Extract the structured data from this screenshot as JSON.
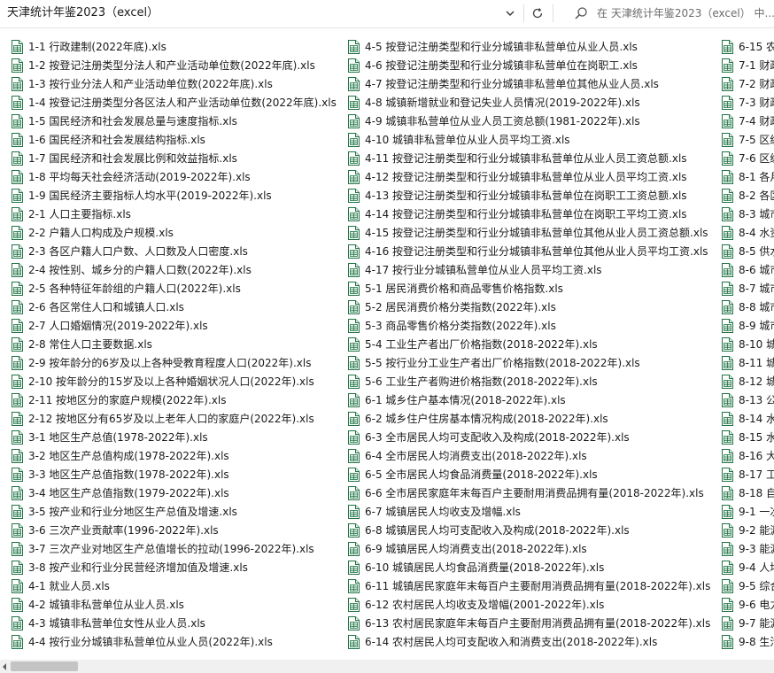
{
  "address_bar": {
    "path": "天津统计年鉴2023（excel）",
    "search_placeholder": "在 天津统计年鉴2023（excel） 中..."
  },
  "icons": {
    "file": "excel-file-icon",
    "dropdown": "chevron-down-icon",
    "refresh": "refresh-icon",
    "search": "search-icon"
  },
  "colors": {
    "excel_green": "#217346",
    "scrollbar_thumb": "#c4c4c4"
  },
  "files": {
    "column1": [
      "1-1 行政建制(2022年底).xls",
      "1-2 按登记注册类型分法人和产业活动单位数(2022年底).xls",
      "1-3 按行业分法人和产业活动单位数(2022年底).xls",
      "1-4 按登记注册类型分各区法人和产业活动单位数(2022年底).xls",
      "1-5 国民经济和社会发展总量与速度指标.xls",
      "1-6 国民经济和社会发展结构指标.xls",
      "1-7 国民经济和社会发展比例和效益指标.xls",
      "1-8 平均每天社会经济活动(2019-2022年).xls",
      "1-9 国民经济主要指标人均水平(2019-2022年).xls",
      "2-1 人口主要指标.xls",
      "2-2 户籍人口构成及户规模.xls",
      "2-3 各区户籍人口户数、人口数及人口密度.xls",
      "2-4 按性别、城乡分的户籍人口数(2022年).xls",
      "2-5 各种特征年龄组的户籍人口(2022年).xls",
      "2-6 各区常住人口和城镇人口.xls",
      "2-7 人口婚姻情况(2019-2022年).xls",
      "2-8 常住人口主要数据.xls",
      "2-9 按年龄分的6岁及以上各种受教育程度人口(2022年).xls",
      "2-10 按年龄分的15岁及以上各种婚姻状况人口(2022年).xls",
      "2-11 按地区分的家庭户规模(2022年).xls",
      "2-12 按地区分有65岁及以上老年人口的家庭户(2022年).xls",
      "3-1 地区生产总值(1978-2022年).xls",
      "3-2 地区生产总值构成(1978-2022年).xls",
      "3-3 地区生产总值指数(1978-2022年).xls",
      "3-4 地区生产总值指数(1979-2022年).xls",
      "3-5 按产业和行业分地区生产总值及增速.xls",
      "3-6 三次产业贡献率(1996-2022年).xls",
      "3-7 三次产业对地区生产总值增长的拉动(1996-2022年).xls",
      "3-8 按产业和行业分民营经济增加值及增速.xls",
      "4-1 就业人员.xls",
      "4-2 城镇非私营单位从业人员.xls",
      "4-3 城镇非私营单位女性从业人员.xls",
      "4-4 按行业分城镇非私营单位从业人员(2022年).xls"
    ],
    "column2": [
      "4-5 按登记注册类型和行业分城镇非私营单位从业人员.xls",
      "4-6 按登记注册类型和行业分城镇非私营单位在岗职工.xls",
      "4-7 按登记注册类型和行业分城镇非私营单位其他从业人员.xls",
      "4-8 城镇新增就业和登记失业人员情况(2019-2022年).xls",
      "4-9 城镇非私营单位从业人员工资总额(1981-2022年).xls",
      "4-10 城镇非私营单位从业人员平均工资.xls",
      "4-11 按登记注册类型和行业分城镇非私营单位从业人员工资总额.xls",
      "4-12 按登记注册类型和行业分城镇非私营单位从业人员平均工资.xls",
      "4-13 按登记注册类型和行业分城镇非私营单位在岗职工工资总额.xls",
      "4-14 按登记注册类型和行业分城镇非私营单位在岗职工平均工资.xls",
      "4-15 按登记注册类型和行业分城镇非私营单位其他从业人员工资总额.xls",
      "4-16 按登记注册类型和行业分城镇非私营单位其他从业人员平均工资.xls",
      "4-17 按行业分城镇私营单位从业人员平均工资.xls",
      "5-1 居民消费价格和商品零售价格指数.xls",
      "5-2 居民消费价格分类指数(2022年).xls",
      "5-3 商品零售价格分类指数(2022年).xls",
      "5-4 工业生产者出厂价格指数(2018-2022年).xls",
      "5-5 按行业分工业生产者出厂价格指数(2018-2022年).xls",
      "5-6 工业生产者购进价格指数(2018-2022年).xls",
      "6-1 城乡住户基本情况(2018-2022年).xls",
      "6-2 城乡住户住房基本情况构成(2018-2022年).xls",
      "6-3 全市居民人均可支配收入及构成(2018-2022年).xls",
      "6-4 全市居民人均消费支出(2018-2022年).xls",
      "6-5 全市居民人均食品消费量(2018-2022年).xls",
      "6-6 全市居民家庭年末每百户主要耐用消费品拥有量(2018-2022年).xls",
      "6-7 城镇居民人均收支及增幅.xls",
      "6-8 城镇居民人均可支配收入及构成(2018-2022年).xls",
      "6-9 城镇居民人均消费支出(2018-2022年).xls",
      "6-10 城镇居民人均食品消费量(2018-2022年).xls",
      "6-11 城镇居民家庭年末每百户主要耐用消费品拥有量(2018-2022年).xls",
      "6-12 农村居民人均收支及增幅(2001-2022年).xls",
      "6-13 农村居民家庭年末每百户主要耐用消费品拥有量(2018-2022年).xls",
      "6-14 农村居民人均可支配收入和消费支出(2018-2022年).xls"
    ],
    "column3": [
      "6-15 农",
      "7-1 财政",
      "7-2 财政",
      "7-3 财政",
      "7-4 财政",
      "7-5 区级",
      "7-6 区级",
      "8-1 各月",
      "8-2 各区",
      "8-3 城市",
      "8-4 水资",
      "8-5 供水",
      "8-6 城市",
      "8-7 城市",
      "8-8 城市",
      "8-9 城市",
      "8-10 城",
      "8-11 城",
      "8-12 城",
      "8-13 公",
      "8-14 水",
      "8-15 水",
      "8-16 大",
      "8-17 工",
      "8-18 自",
      "9-1 一次",
      "9-2 能源",
      "9-3 能源",
      "9-4 人均",
      "9-5 综合",
      "9-6 电力",
      "9-7 能源",
      "9-8 生活"
    ]
  }
}
